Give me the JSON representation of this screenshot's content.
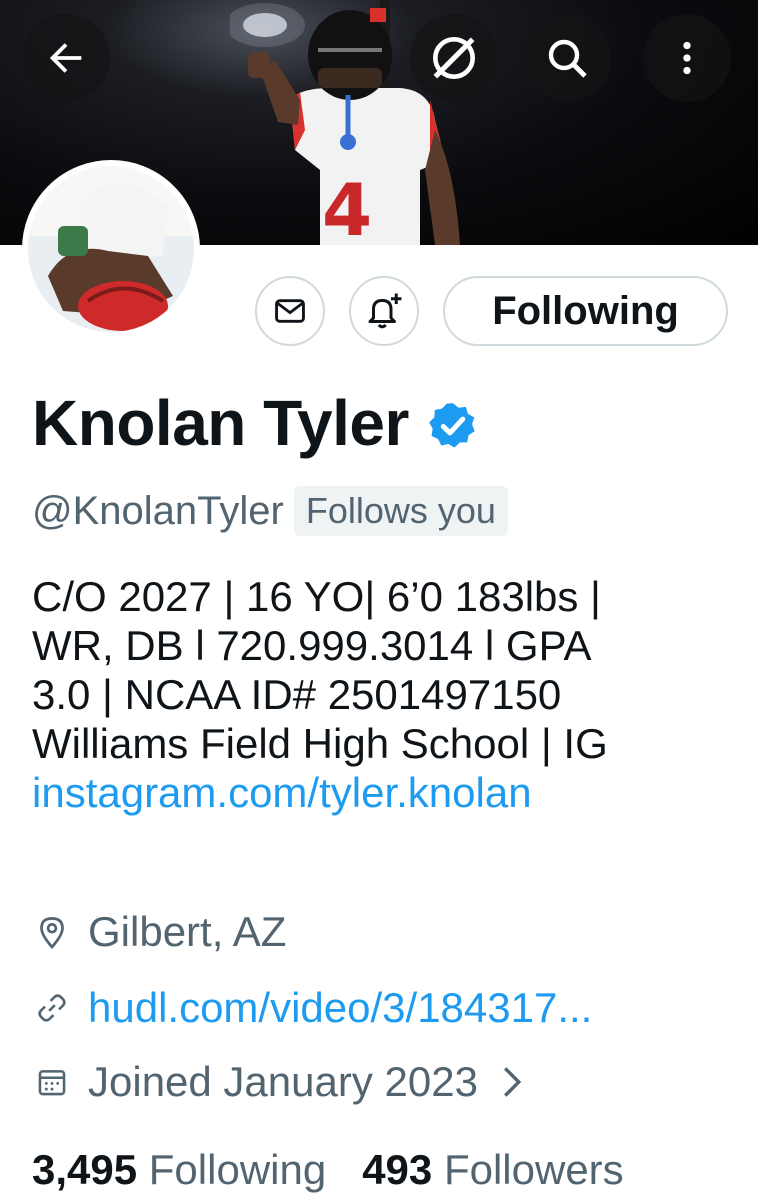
{
  "header": {
    "back_icon": "arrow-left-icon",
    "grok_icon": "slash-circle-icon",
    "search_icon": "search-icon",
    "more_icon": "more-vertical-icon"
  },
  "actions": {
    "message_icon": "envelope-icon",
    "notify_icon": "bell-plus-icon",
    "follow_label": "Following"
  },
  "profile": {
    "name": "Knolan Tyler",
    "handle": "@KnolanTyler",
    "follows_you": "Follows you",
    "bio_line1": "C/O 2027 | 16 YO| 6’0 183lbs |",
    "bio_line2": "WR, DB l 720.999.3014 l GPA",
    "bio_line3": "3.0 | NCAA ID# 2501497150",
    "bio_line4": "Williams Field High School | IG",
    "bio_link": "instagram.com/tyler.knolan",
    "location": "Gilbert, AZ",
    "website": "hudl.com/video/3/184317...",
    "joined": "Joined January 2023",
    "following_count": "3,495",
    "following_label": "Following",
    "followers_count": "493",
    "followers_label": "Followers",
    "jersey_number": "4"
  },
  "colors": {
    "accent": "#1d9bf0",
    "text": "#0f1419",
    "muted": "#536471",
    "border": "#cfd9de"
  }
}
